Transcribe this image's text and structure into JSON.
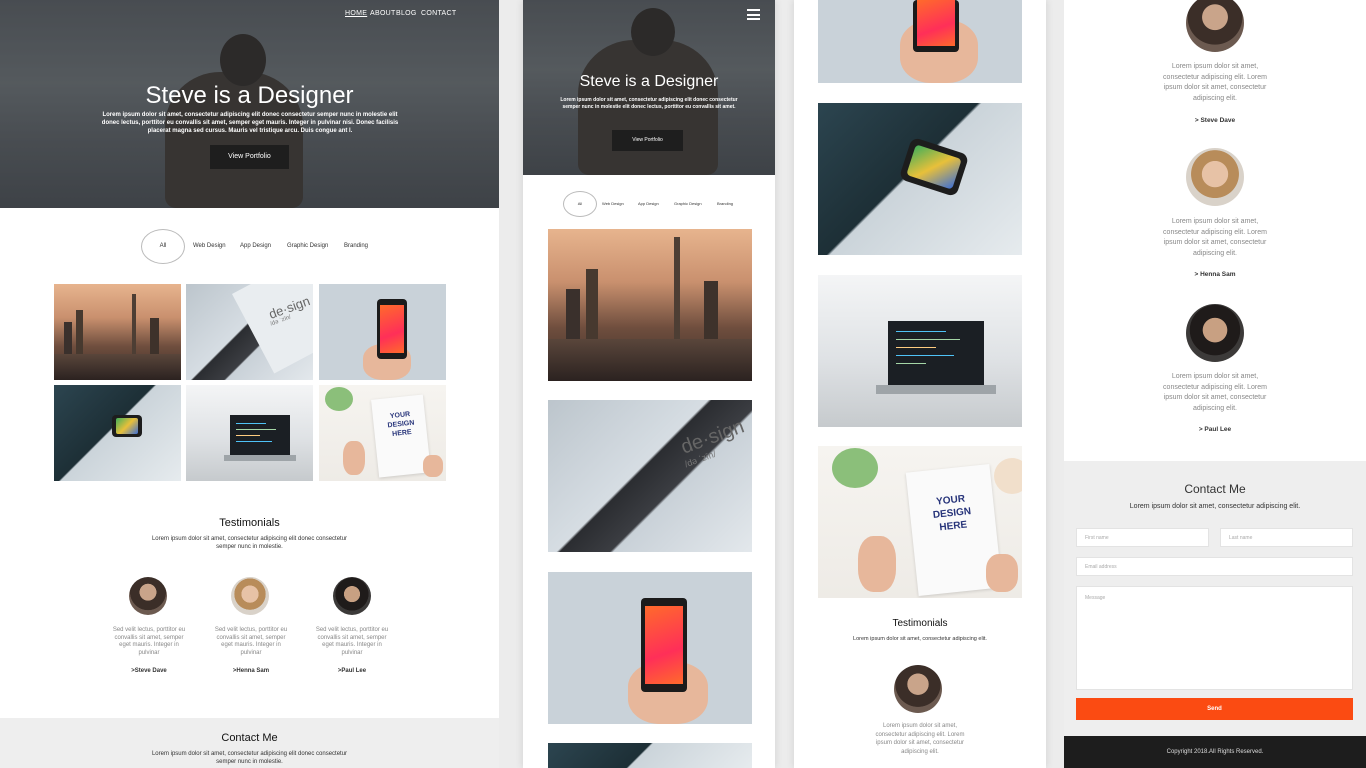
{
  "colors": {
    "accent": "#fb4b12",
    "dark_button": "#1e1e1e",
    "footer_bg": "#1d1d1d",
    "contact_bg": "#eeeeee"
  },
  "nav": {
    "home": "HOME",
    "about": "ABOUT",
    "blog": "BLOG",
    "contact": "CONTACT"
  },
  "hero": {
    "title": "Steve is a Designer",
    "subtitle": "Lorem ipsum dolor sit amet, consectetur adipiscing elit donec consectetur semper nunc in molestie elit donec lectus, porttitor eu convallis sit amet, semper eget mauris. Integer in pulvinar nisi. Donec facilisis placerat magna sed cursus. Mauris vel tristique arcu. Duis congue ant l.",
    "subtitle_mobile": "Lorem ipsum dolor sit amet, consectetur adipiscing elit donec consectetur semper nunc in molestie elit donec lectus, porttitor eu convallis sit amet.",
    "button": "View Portfolio"
  },
  "filters": [
    "All",
    "Web Design",
    "App Design",
    "Graphic Design",
    "Branding"
  ],
  "testimonials": {
    "title": "Testimonials",
    "intro": "Lorem ipsum dolor sit amet, consectetur adipiscing elit donec consectetur semper nunc in molestie.",
    "intro_mobile": "Lorem ipsum dolor sit amet, consectetur adipiscing elit.",
    "quote": "Sed velit lectus, porttitor eu convallis sit amet, semper eget mauris. Integer in pulvinar",
    "quote_mobile": "Lorem ipsum dolor sit amet, consectetur adipiscing elit. Lorem ipsum dolor sit amet, consectetur adipiscing elit.",
    "people": [
      {
        "name": ">Steve Dave",
        "mobile_name": "> Steve Dave",
        "avatar": "avatar-steve"
      },
      {
        "name": ">Henna Sam",
        "mobile_name": "> Henna Sam",
        "avatar": "avatar-henna"
      },
      {
        "name": ">Paul Lee",
        "mobile_name": "> Paul Lee",
        "avatar": "avatar-paul"
      }
    ]
  },
  "contact": {
    "title": "Contact Me",
    "intro": "Lorem ipsum dolor sit amet, consectetur adipiscing elit donec consectetur semper nunc in molestie.",
    "intro_mobile": "Lorem ipsum dolor sit amet, consectetur adipiscing elit.",
    "first_name": "First name",
    "last_name": "Last name",
    "email": "Email address",
    "message": "Message",
    "send": "Send"
  },
  "footer": {
    "copyright": "Copyright 2018.All Rights Reserved."
  },
  "icons": {
    "menu": "hamburger-menu-icon"
  },
  "mockup_text": {
    "design": "de·sign",
    "design_sub": "/də ˈzīn/",
    "your_design_here": "YOUR DESIGN HERE"
  }
}
